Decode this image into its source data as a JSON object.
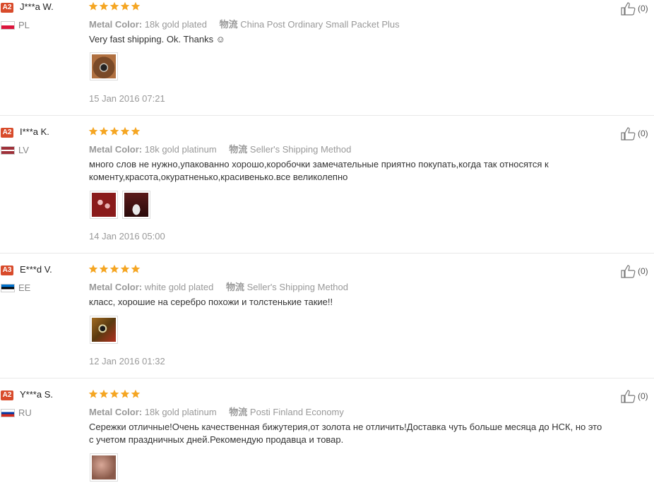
{
  "colors": {
    "badge": "#d84b2b",
    "star": "#f5a623",
    "muted": "#999999"
  },
  "reviews": [
    {
      "badge": "A2",
      "name": "J***a W.",
      "country": "PL",
      "flag": "pl-flag",
      "rating": 5,
      "color_label": "Metal Color:",
      "color_value": "18k gold plated",
      "logistics_label": "物流",
      "logistics_value": "China Post Ordinary Small Packet Plus",
      "text": "Very fast shipping. Ok. Thanks ☺",
      "date": "15 Jan 2016 07:21",
      "likes": "(0)",
      "photos": 1
    },
    {
      "badge": "A2",
      "name": "I***a K.",
      "country": "LV",
      "flag": "lv-flag",
      "rating": 5,
      "color_label": "Metal Color:",
      "color_value": "18k gold platinum",
      "logistics_label": "物流",
      "logistics_value": "Seller's Shipping Method",
      "text": "много слов не нужно,упакованно хорошо,коробочки замечательные приятно покупать,когда так относятся к коменту,красота,окуратненько,красивенько.все великолепно",
      "date": "14 Jan 2016 05:00",
      "likes": "(0)",
      "photos": 2
    },
    {
      "badge": "A3",
      "name": "E***d V.",
      "country": "EE",
      "flag": "ee-flag",
      "rating": 5,
      "color_label": "Metal Color:",
      "color_value": "white gold plated",
      "logistics_label": "物流",
      "logistics_value": "Seller's Shipping Method",
      "text": "класс, хорошие на серебро похожи и толстенькие такие!!",
      "date": "12 Jan 2016 01:32",
      "likes": "(0)",
      "photos": 1
    },
    {
      "badge": "A2",
      "name": "Y***a S.",
      "country": "RU",
      "flag": "ru-flag",
      "rating": 5,
      "color_label": "Metal Color:",
      "color_value": "18k gold platinum",
      "logistics_label": "物流",
      "logistics_value": "Posti Finland Economy",
      "text": "Сережки отличные!Очень качественная бижутерия,от золота не отличить!Доставка чуть больше месяца до НСК, но это с учетом праздничных дней.Рекомендую продавца и товар.",
      "date": "",
      "likes": "(0)",
      "photos": 1
    }
  ]
}
